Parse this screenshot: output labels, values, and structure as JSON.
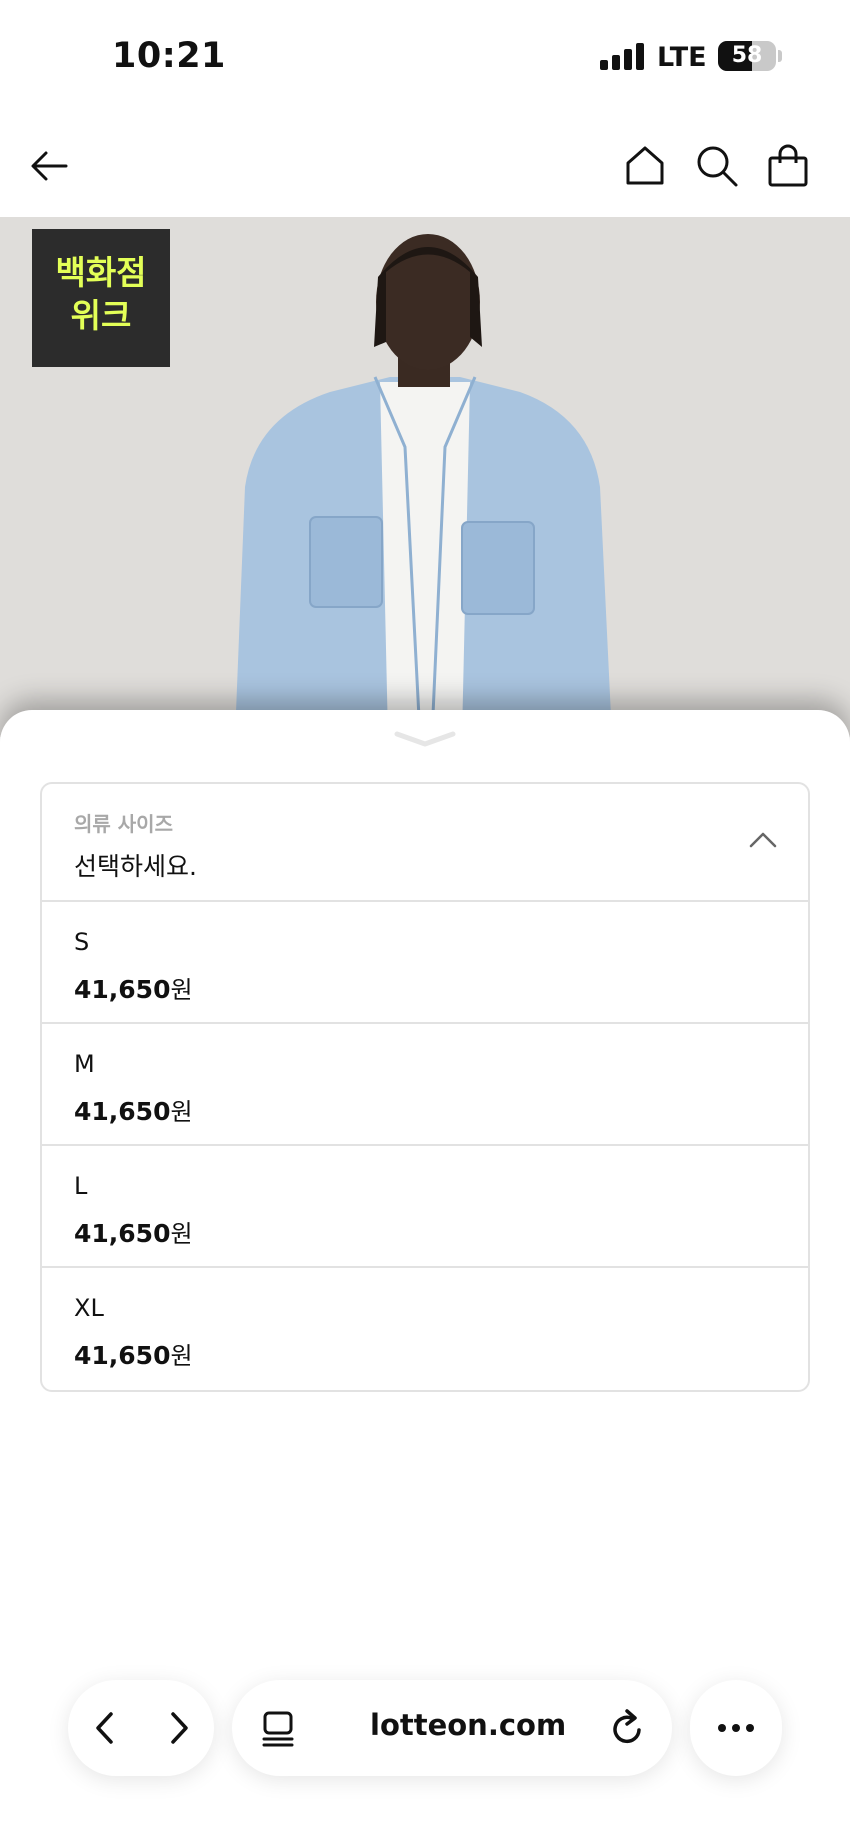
{
  "status_bar": {
    "time": "10:21",
    "network": "LTE",
    "battery": "58",
    "battery_level": 0.58
  },
  "top_nav": {
    "back_icon": "arrow-left-icon",
    "home_icon": "home-icon",
    "search_icon": "search-icon",
    "cart_icon": "shopping-bag-icon"
  },
  "hero": {
    "badge_line1": "백화점",
    "badge_line2": "위크",
    "badge_text_color": "#e3ff57"
  },
  "size_select": {
    "label": "의류 사이즈",
    "value": "선택하세요.",
    "options": [
      {
        "name": "S",
        "price": "41,650",
        "currency": "원"
      },
      {
        "name": "M",
        "price": "41,650",
        "currency": "원"
      },
      {
        "name": "L",
        "price": "41,650",
        "currency": "원"
      },
      {
        "name": "XL",
        "price": "41,650",
        "currency": "원"
      }
    ]
  },
  "browser": {
    "url": "lotteon.com",
    "back_icon": "chevron-left-icon",
    "forward_icon": "chevron-right-icon",
    "tabs_icon": "tabs-icon",
    "reload_icon": "reload-icon",
    "more_icon": "more-icon"
  }
}
